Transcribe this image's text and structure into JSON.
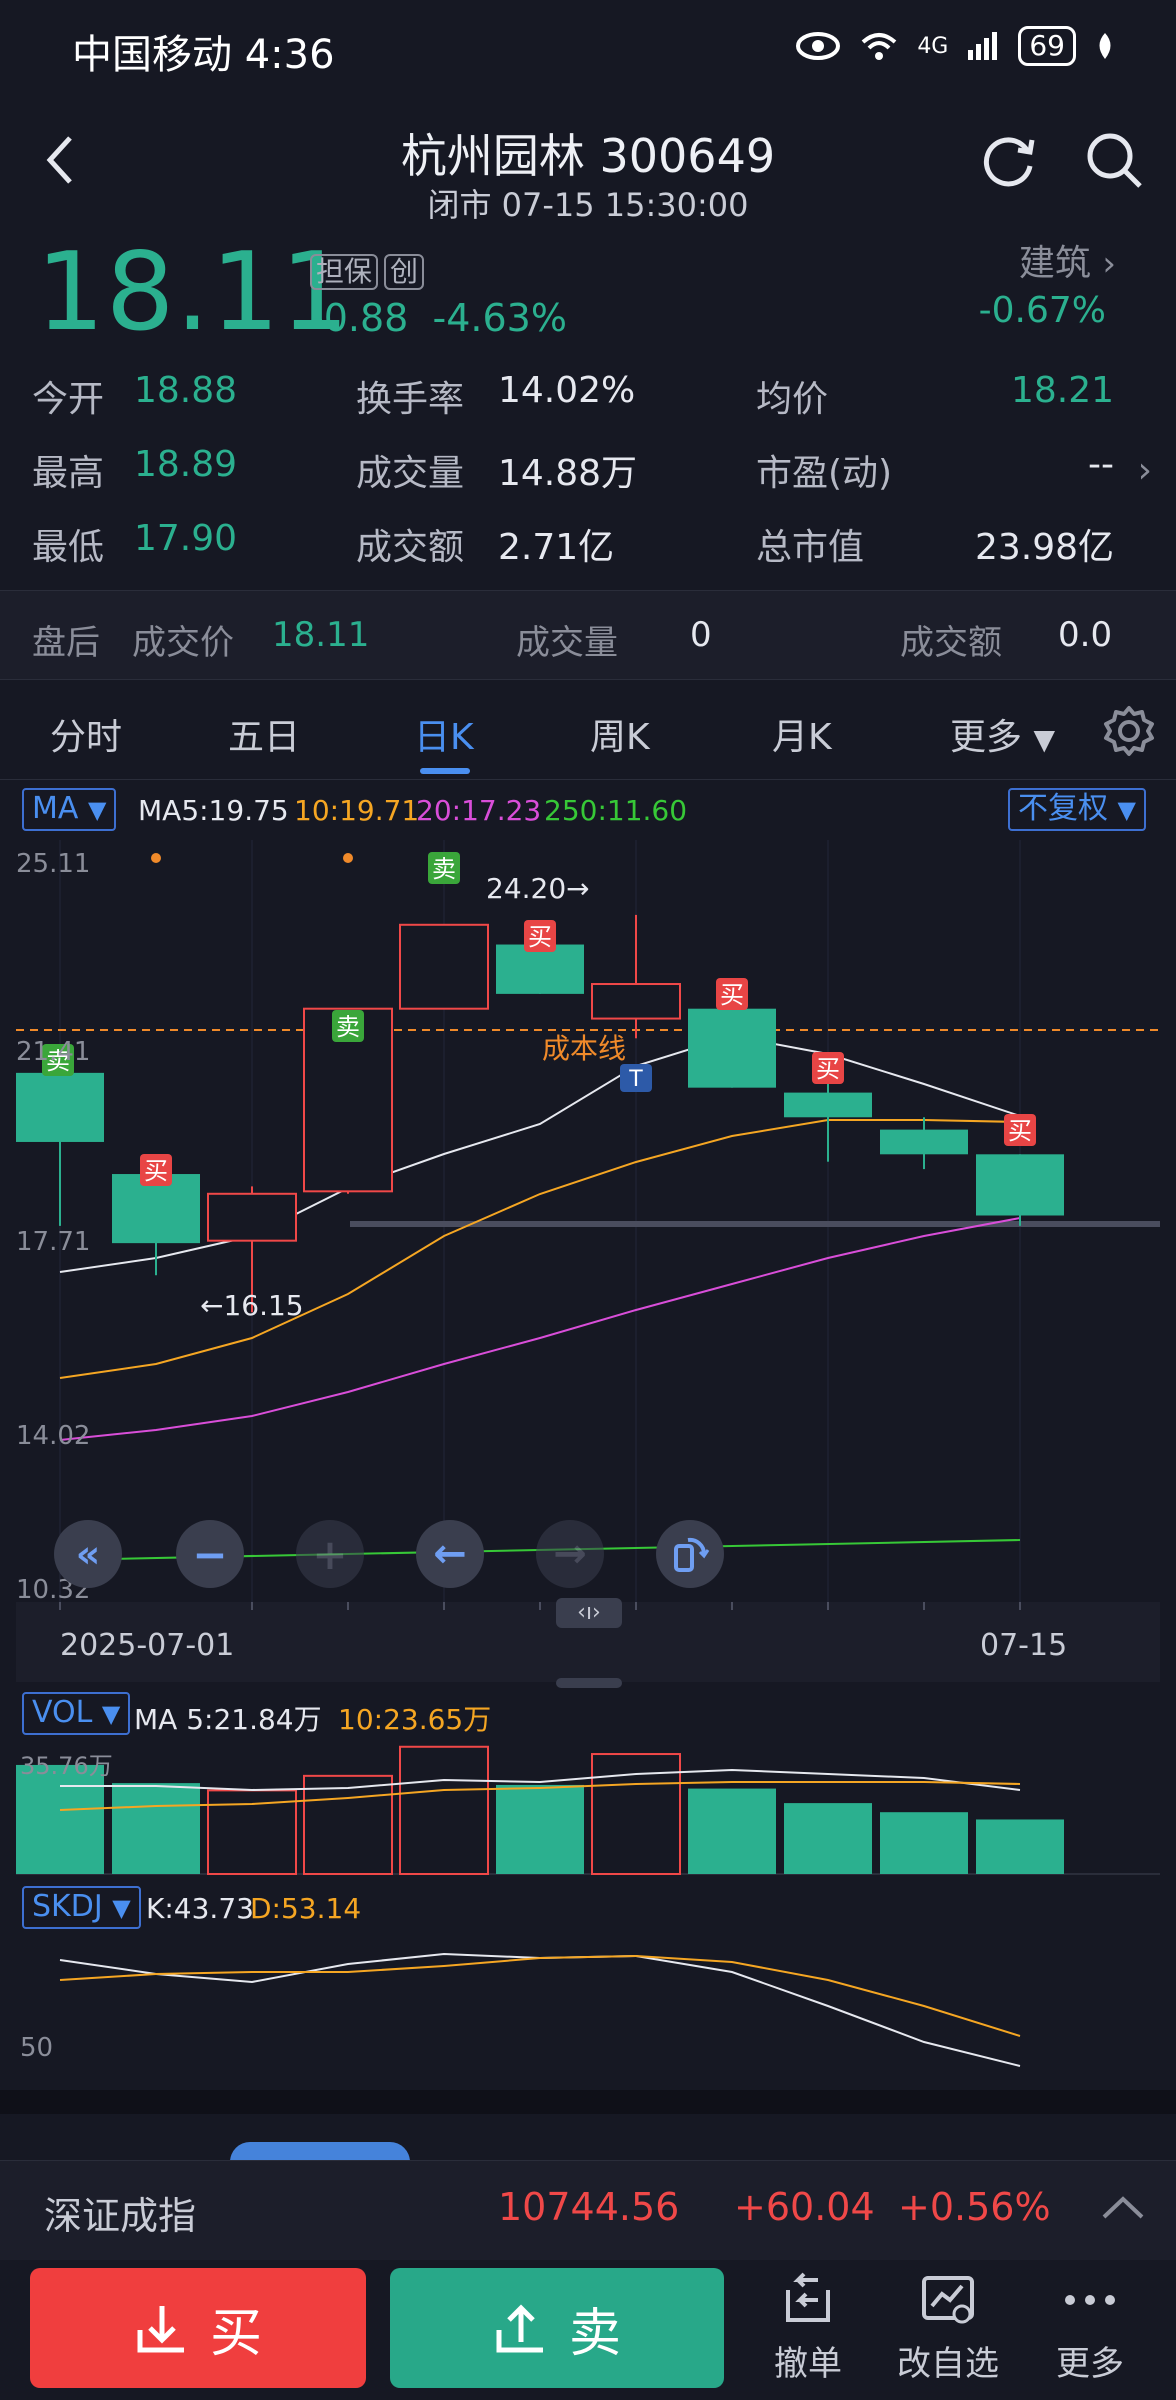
{
  "status_bar": {
    "carrier_time": "中国移动 4:36",
    "network": "4G",
    "battery": "69"
  },
  "header": {
    "title": "杭州园林 300649",
    "subtitle": "闭市 07-15 15:30:00"
  },
  "quote": {
    "price": "18.11",
    "tag1": "担保",
    "tag2": "创",
    "change": "-0.88",
    "change_pct": "-4.63%",
    "sector": "建筑",
    "sector_change": "-0.67%"
  },
  "stats": [
    {
      "label": "今开",
      "value": "18.88"
    },
    {
      "label": "换手率",
      "value": "14.02%"
    },
    {
      "label": "均价",
      "value": "18.21"
    },
    {
      "label": "最高",
      "value": "18.89"
    },
    {
      "label": "成交量",
      "value": "14.88万"
    },
    {
      "label": "市盈(动)",
      "value": "--"
    },
    {
      "label": "最低",
      "value": "17.90"
    },
    {
      "label": "成交额",
      "value": "2.71亿"
    },
    {
      "label": "总市值",
      "value": "23.98亿"
    }
  ],
  "after_hours": {
    "label": "盘后",
    "price_label": "成交价",
    "price": "18.11",
    "volume_label": "成交量",
    "volume": "0",
    "amount_label": "成交额",
    "amount": "0.0"
  },
  "tabs": [
    "分时",
    "五日",
    "日K",
    "周K",
    "月K",
    "更多"
  ],
  "kline": {
    "ma_select": "MA",
    "ma5": "MA5:19.75",
    "ma10": "10:19.71",
    "ma20": "20:17.23",
    "ma250": "250:11.60",
    "adjust": "不复权",
    "y_labels": [
      "25.11",
      "21.41",
      "17.71",
      "14.02",
      "10.32"
    ],
    "x_labels": [
      "2025-07-01",
      "07-15"
    ],
    "annot_high": "24.20→",
    "annot_low": "←16.15",
    "cost_line": "成本线",
    "marks": {
      "sell": "卖",
      "buy": "买",
      "t": "T"
    },
    "pan_hint": "‹ı›",
    "colors": {
      "up": "#f04848",
      "down": "#2bb08f"
    }
  },
  "vol": {
    "select": "VOL",
    "ma5": "MA 5:21.84万",
    "ma10": "10:23.65万",
    "y_label": "35.76万"
  },
  "skdj": {
    "select": "SKDJ",
    "k": "K:43.73",
    "d": "D:53.14",
    "y_label": "50"
  },
  "chart_data": [
    {
      "type": "candlestick",
      "title": "日K",
      "candles": [
        {
          "o": 21.0,
          "h": 21.5,
          "l": 17.9,
          "c": 19.6
        },
        {
          "o": 18.95,
          "h": 19.15,
          "l": 16.9,
          "c": 17.55
        },
        {
          "o": 17.6,
          "h": 18.7,
          "l": 16.15,
          "c": 18.55
        },
        {
          "o": 18.6,
          "h": 22.3,
          "l": 18.55,
          "c": 22.3
        },
        {
          "o": 22.3,
          "h": 24.0,
          "l": 22.3,
          "c": 24.0
        },
        {
          "o": 23.6,
          "h": 23.6,
          "l": 22.6,
          "c": 22.6
        },
        {
          "o": 22.1,
          "h": 24.2,
          "l": 21.7,
          "c": 22.8
        },
        {
          "o": 22.3,
          "h": 22.3,
          "l": 20.7,
          "c": 20.7
        },
        {
          "o": 20.6,
          "h": 20.8,
          "l": 19.2,
          "c": 20.1
        },
        {
          "o": 19.85,
          "h": 20.1,
          "l": 19.05,
          "c": 19.35
        },
        {
          "o": 19.35,
          "h": 19.35,
          "l": 17.9,
          "c": 18.11
        }
      ],
      "ma5": [
        17.6,
        null,
        18.2,
        19.4,
        20.6,
        null,
        21.6,
        null,
        null,
        null,
        19.75
      ],
      "ylim": [
        10.32,
        25.11
      ]
    },
    {
      "type": "bar",
      "title": "VOL",
      "values": [
        30,
        25,
        23,
        27,
        35,
        24.5,
        33,
        23.5,
        19.5,
        17,
        15
      ],
      "unit": "万",
      "ylim": [
        0,
        35.76
      ]
    }
  ],
  "bottom_index": {
    "name": "深证成指",
    "value": "10744.56",
    "change": "+60.04",
    "pct": "+0.56%"
  },
  "actions": {
    "buy": "买",
    "sell": "卖",
    "cancel": "撤单",
    "watch": "改自选",
    "more": "更多"
  }
}
